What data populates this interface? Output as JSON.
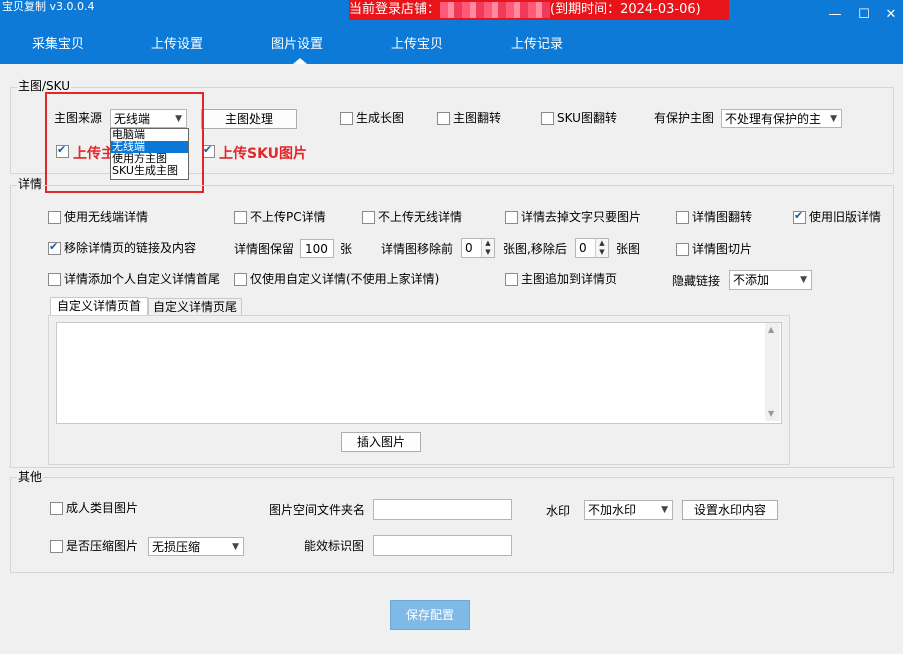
{
  "app": {
    "title": "宝贝复制 v3.0.0.4",
    "store_prefix": "当前登录店铺：",
    "expiry": "(到期时间：2024-03-06)"
  },
  "window": {
    "minimize": "—",
    "maximize": "☐",
    "close": "✕"
  },
  "tabs": [
    "采集宝贝",
    "上传设置",
    "图片设置",
    "上传宝贝",
    "上传记录"
  ],
  "active_tab": 2,
  "main_sku": {
    "legend": "主图/SKU",
    "source_label": "主图来源",
    "source_value": "无线端",
    "source_options": [
      "电脑端",
      "无线端",
      "使用方主图",
      "SKU生成主图"
    ],
    "process_button": "主图处理",
    "long_image": "生成长图",
    "flip_main": "主图翻转",
    "flip_sku": "SKU图翻转",
    "protected_label": "有保护主图",
    "protected_value": "不处理有保护的主",
    "upload_main": "上传主",
    "upload_sku": "上传SKU图片"
  },
  "details": {
    "legend": "详情",
    "use_wireless": "使用无线端详情",
    "no_pc": "不上传PC详情",
    "no_wireless": "不上传无线详情",
    "strip_text": "详情去掉文字只要图片",
    "flip_detail": "详情图翻转",
    "use_old": "使用旧版详情",
    "remove_links": "移除详情页的链接及内容",
    "keep_label": "详情图保留",
    "keep_value": "100",
    "keep_unit": "张",
    "remove_front_label": "详情图移除前",
    "remove_front_value": "0",
    "remove_back_label": "张图,移除后",
    "remove_back_value": "0",
    "remove_back_unit": "张图",
    "slice": "详情图切片",
    "add_header": "详情添加个人自定义详情首尾",
    "only_custom": "仅使用自定义详情(不使用上家详情)",
    "append_main": "主图追加到详情页",
    "hide_link_label": "隐藏链接",
    "hide_link_value": "不添加",
    "subtab_head": "自定义详情页首",
    "subtab_tail": "自定义详情页尾",
    "insert_image": "插入图片"
  },
  "other": {
    "legend": "其他",
    "adult_images": "成人类目图片",
    "folder_label": "图片空间文件夹名",
    "watermark_label": "水印",
    "watermark_value": "不加水印",
    "watermark_button": "设置水印内容",
    "compress": "是否压缩图片",
    "compress_value": "无损压缩",
    "energy_label": "能效标识图"
  },
  "save_button": "保存配置",
  "colors": {
    "accent": "#0e7ad8",
    "banner": "#e8141a",
    "highlight": "#e3262a"
  }
}
